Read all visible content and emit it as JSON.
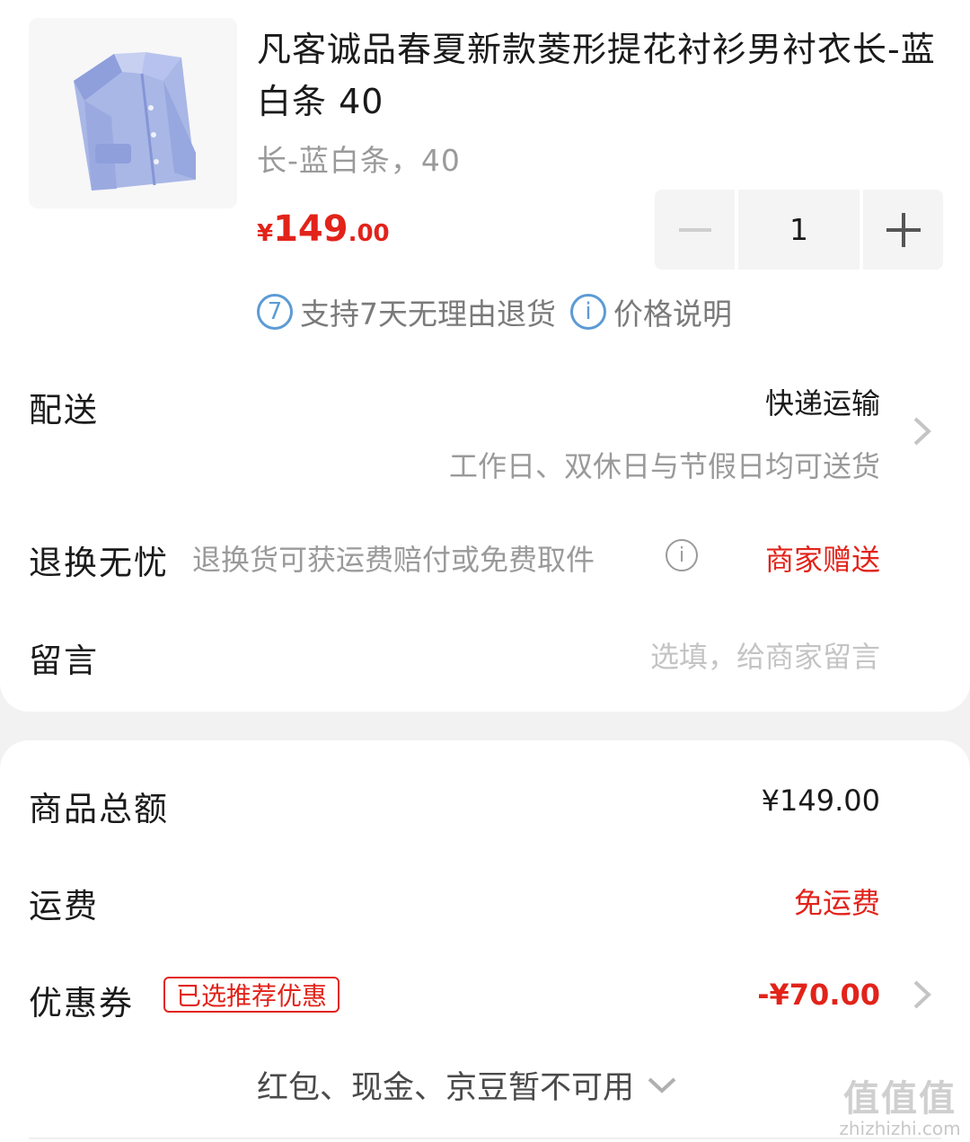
{
  "product": {
    "title": "凡客诚品春夏新款菱形提花衬衫男衬衣长-蓝白条 40",
    "spec": "长-蓝白条，40",
    "price_symbol": "¥",
    "price_integer": "149",
    "price_decimal": ".00",
    "quantity": "1",
    "services": [
      {
        "icon": "7",
        "label": "支持7天无理由退货"
      },
      {
        "icon": "i",
        "label": "价格说明"
      }
    ]
  },
  "delivery": {
    "label": "配送",
    "method": "快递运输",
    "note": "工作日、双休日与节假日均可送货"
  },
  "returns": {
    "label": "退换无忧",
    "desc": "退换货可获运费赔付或免费取件",
    "status": "商家赠送"
  },
  "message": {
    "label": "留言",
    "placeholder": "选填，给商家留言"
  },
  "summary": {
    "goods_total_label": "商品总额",
    "goods_total_value": "¥149.00",
    "shipping_label": "运费",
    "shipping_value": "免运费",
    "coupon_label": "优惠券",
    "coupon_tag": "已选推荐优惠",
    "coupon_value": "-¥70.00",
    "unavailable_note": "红包、现金、京豆暂不可用"
  },
  "watermark": {
    "glyphs": "值值值",
    "site": "zhizhizhi.com"
  },
  "colors": {
    "accent_red": "#e2231a",
    "info_blue": "#5b9bd5",
    "muted_gray": "#9a9a9a"
  }
}
